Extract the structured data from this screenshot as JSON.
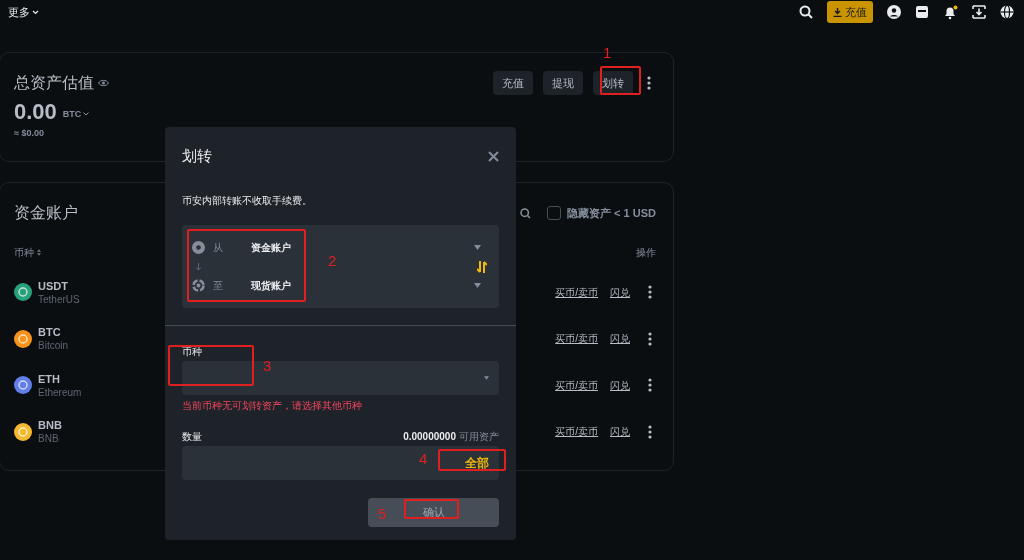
{
  "top_bar": {
    "more_menu": "更多",
    "deposit_button": "充值"
  },
  "overview": {
    "title": "总资产估值",
    "amount": "0.00",
    "unit": "BTC",
    "fiat": "≈ $0.00",
    "buttons": [
      "充值",
      "提现",
      "划转"
    ]
  },
  "funding": {
    "title": "资金账户",
    "hide_small": {
      "label": "隐藏资产 < 1 USD",
      "checked": false
    },
    "columns": [
      "币种",
      "操作"
    ],
    "rows": [
      {
        "symbol": "USDT",
        "name": "TetherUS",
        "color": "#26a17b",
        "actions": [
          "买币/卖币",
          "闪兑"
        ]
      },
      {
        "symbol": "BTC",
        "name": "Bitcoin",
        "color": "#f7931a",
        "actions": [
          "买币/卖币",
          "闪兑"
        ]
      },
      {
        "symbol": "ETH",
        "name": "Ethereum",
        "color": "#627eea",
        "actions": [
          "买币/卖币",
          "闪兑"
        ]
      },
      {
        "symbol": "BNB",
        "name": "BNB",
        "color": "#f3ba2f",
        "actions": [
          "买币/卖币",
          "闪兑"
        ]
      }
    ]
  },
  "dialog": {
    "title": "划转",
    "note": "币安内部转账不收取手续费。",
    "from": {
      "label": "从",
      "account": "资金账户"
    },
    "to": {
      "label": "至",
      "account": "现货账户"
    },
    "coin": {
      "label": "币种",
      "error": "当前币种无可划转资产，请选择其他币种"
    },
    "amount": {
      "label": "数量",
      "balance": "0.00000000",
      "balance_label": "可用资产",
      "max_button": "全部"
    },
    "confirm": {
      "label": "确认",
      "disabled": true
    }
  },
  "annotations": [
    {
      "label": "1"
    },
    {
      "label": "2"
    },
    {
      "label": "3"
    },
    {
      "label": "4"
    },
    {
      "label": "5"
    }
  ]
}
